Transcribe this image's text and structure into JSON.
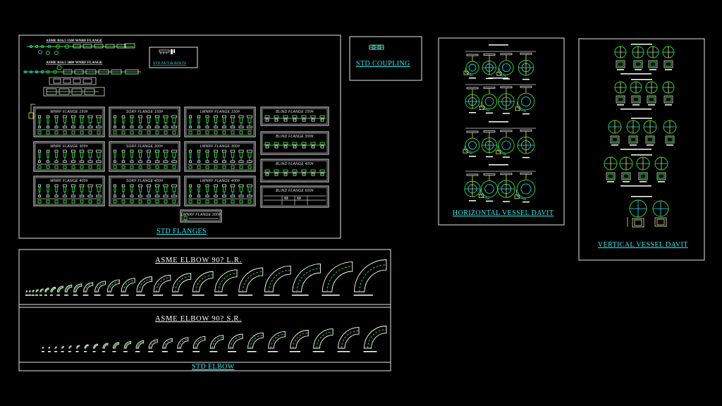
{
  "labels": {
    "wnrf150_header": "ASME B16.5 150# WNRF FLANGE",
    "wnrf300_header": "ASME B16.5 300# WNRF FLANGE",
    "nut_bolts": "STD NUT & BOLTS",
    "coupling": "STD COUPLING",
    "std_flanges": "STD FLANGES",
    "h_davit": "HORIZONTAL VESSEL DAVIT",
    "v_davit": "VERTICAL VESSEL DAVIT",
    "elbow_lr": "ASME ELBOW 90? L.R.",
    "elbow_sr": "ASME ELBOW 90? S.R.",
    "std_elbow": "STD ELBOW"
  },
  "flange_panels": [
    "WNRF FLANGE 150#",
    "SORF FLANGE 150#",
    "LWNRF FLANGE 150#",
    "BLIND FLANGE 150#",
    "WNRF FLANGE 300#",
    "SORF FLANGE 300#",
    "LWNRF FLANGE 300#",
    "BLIND FLANGE 300#",
    "WNRF FLANGE 400#",
    "SORF FLANGE 400#",
    "LWNRF FLANGE 400#",
    "BLIND FLANGE 400#",
    "BLIND FLANGE 600#",
    "LWNRF FLANGE 300#"
  ],
  "colors": {
    "frame": "#e6e6e6",
    "title_cyan": "#31e8f0",
    "drawing_green": "#33e233",
    "accent_yellow": "#f2e84a",
    "background": "#000000"
  }
}
